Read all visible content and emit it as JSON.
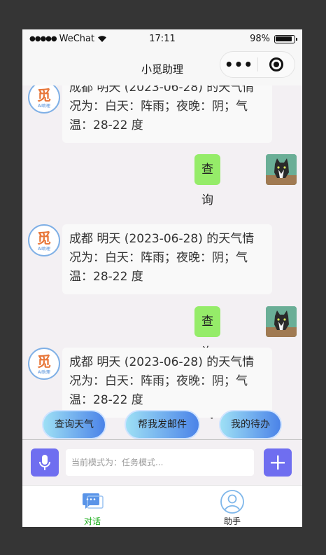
{
  "statusbar": {
    "signal": "●●●●●",
    "carrier": "WeChat",
    "time": "17:11",
    "battery": "98%"
  },
  "navbar": {
    "title": "小觅助理",
    "more_icon": "•••",
    "close_icon": "record-icon"
  },
  "bot_avatar": {
    "text": "觅",
    "subtext": "AI助理"
  },
  "messages": [
    {
      "role": "bot",
      "text": "成都 明天 (2023-06-28) 的天气情况为：白天：阵雨；夜晚：阴；气温：28-22 度"
    },
    {
      "role": "user",
      "text": "查询天气"
    },
    {
      "role": "bot",
      "text": "成都 明天 (2023-06-28) 的天气情况为：白天：阵雨；夜晚：阴；气温：28-22 度"
    },
    {
      "role": "user",
      "text": "查询天气"
    },
    {
      "role": "bot",
      "text": "成都 明天 (2023-06-28) 的天气情况为：白天：阵雨；夜晚：阴；气温：28-22 度"
    }
  ],
  "quick_actions": [
    "查询天气",
    "帮我发邮件",
    "我的待办"
  ],
  "input": {
    "placeholder": "当前模式为：任务模式..."
  },
  "tabs": [
    {
      "label": "对话",
      "active": true,
      "color": "#1aad19"
    },
    {
      "label": "助手",
      "active": false,
      "color": "#222222"
    }
  ],
  "colors": {
    "accent": "#6f6ef0",
    "user_bubble": "#95ec69",
    "active_tab": "#1aad19"
  }
}
